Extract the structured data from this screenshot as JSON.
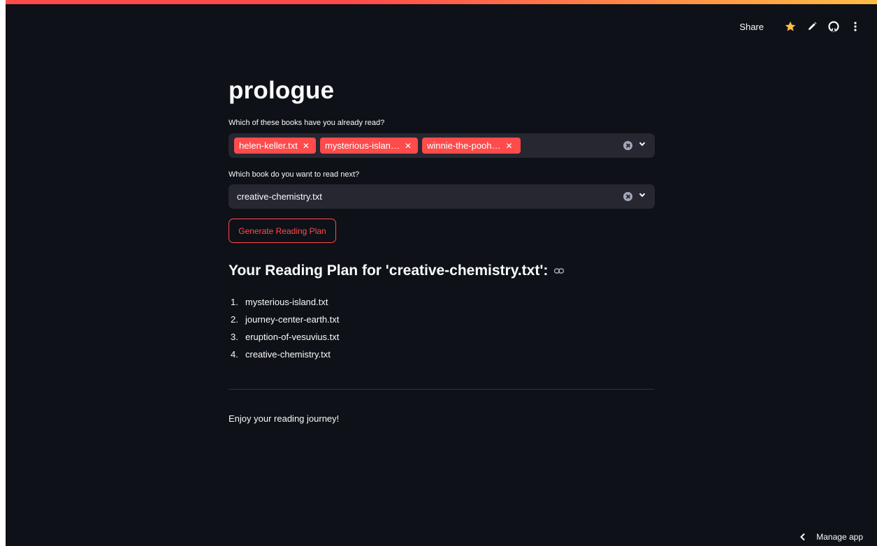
{
  "colors": {
    "background": "#0e1117",
    "accent": "#ff4b4b",
    "input_bg": "#262730",
    "text": "#fafafa"
  },
  "toolbar": {
    "share_label": "Share",
    "icons": [
      "star-icon",
      "edit-icon",
      "github-icon",
      "more-vertical-icon"
    ]
  },
  "main": {
    "title": "prologue",
    "read_books": {
      "label": "Which of these books have you already read?",
      "tags": [
        {
          "label": "helen-keller.txt"
        },
        {
          "label": "mysterious-islan…"
        },
        {
          "label": "winnie-the-pooh…"
        }
      ]
    },
    "next_book": {
      "label": "Which book do you want to read next?",
      "value": "creative-chemistry.txt"
    },
    "generate_button_label": "Generate Reading Plan",
    "plan": {
      "heading": "Your Reading Plan for 'creative-chemistry.txt':",
      "items": [
        {
          "number": "1.",
          "label": "mysterious-island.txt"
        },
        {
          "number": "2.",
          "label": "journey-center-earth.txt"
        },
        {
          "number": "3.",
          "label": "eruption-of-vesuvius.txt"
        },
        {
          "number": "4.",
          "label": "creative-chemistry.txt"
        }
      ]
    },
    "footer_text": "Enjoy your reading journey!"
  },
  "manage_app_label": "Manage app"
}
